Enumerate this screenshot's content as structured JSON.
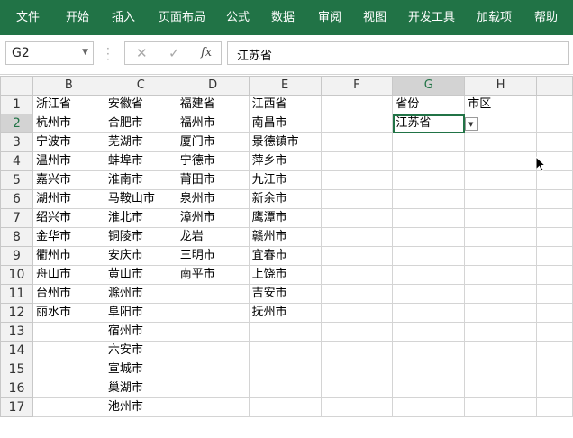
{
  "ribbon": {
    "tabs": [
      "文件",
      "开始",
      "插入",
      "页面布局",
      "公式",
      "数据",
      "审阅",
      "视图",
      "开发工具",
      "加载项",
      "帮助"
    ],
    "bg_color": "#217346"
  },
  "formula_bar": {
    "name_box": "G2",
    "cancel_icon": "✕",
    "enter_icon": "✓",
    "fx_label": "fx",
    "content": "江苏省"
  },
  "sheet": {
    "columns": [
      "B",
      "C",
      "D",
      "E",
      "F",
      "G",
      "H"
    ],
    "rows": [
      [
        "浙江省",
        "安徽省",
        "福建省",
        "江西省",
        "",
        "省份",
        "市区"
      ],
      [
        "杭州市",
        "合肥市",
        "福州市",
        "南昌市",
        "",
        "江苏省",
        ""
      ],
      [
        "宁波市",
        "芜湖市",
        "厦门市",
        "景德镇市",
        "",
        "",
        ""
      ],
      [
        "温州市",
        "蚌埠市",
        "宁德市",
        "萍乡市",
        "",
        "",
        ""
      ],
      [
        "嘉兴市",
        "淮南市",
        "莆田市",
        "九江市",
        "",
        "",
        ""
      ],
      [
        "湖州市",
        "马鞍山市",
        "泉州市",
        "新余市",
        "",
        "",
        ""
      ],
      [
        "绍兴市",
        "淮北市",
        "漳州市",
        "鹰潭市",
        "",
        "",
        ""
      ],
      [
        "金华市",
        "铜陵市",
        "龙岩",
        "赣州市",
        "",
        "",
        ""
      ],
      [
        "衢州市",
        "安庆市",
        "三明市",
        "宜春市",
        "",
        "",
        ""
      ],
      [
        "舟山市",
        "黄山市",
        "南平市",
        "上饶市",
        "",
        "",
        ""
      ],
      [
        "台州市",
        "滁州市",
        "",
        "吉安市",
        "",
        "",
        ""
      ],
      [
        "丽水市",
        "阜阳市",
        "",
        "抚州市",
        "",
        "",
        ""
      ],
      [
        "",
        "宿州市",
        "",
        "",
        "",
        "",
        ""
      ],
      [
        "",
        "六安市",
        "",
        "",
        "",
        "",
        ""
      ],
      [
        "",
        "宣城市",
        "",
        "",
        "",
        "",
        ""
      ],
      [
        "",
        "巢湖市",
        "",
        "",
        "",
        "",
        ""
      ],
      [
        "",
        "池州市",
        "",
        "",
        "",
        "",
        ""
      ]
    ],
    "row_numbers": [
      "1",
      "2",
      "3",
      "4",
      "5",
      "6",
      "7",
      "8",
      "9",
      "10",
      "11",
      "12",
      "13",
      "14",
      "15",
      "16",
      "17"
    ],
    "selected_column": "G",
    "selected_row": "2"
  }
}
